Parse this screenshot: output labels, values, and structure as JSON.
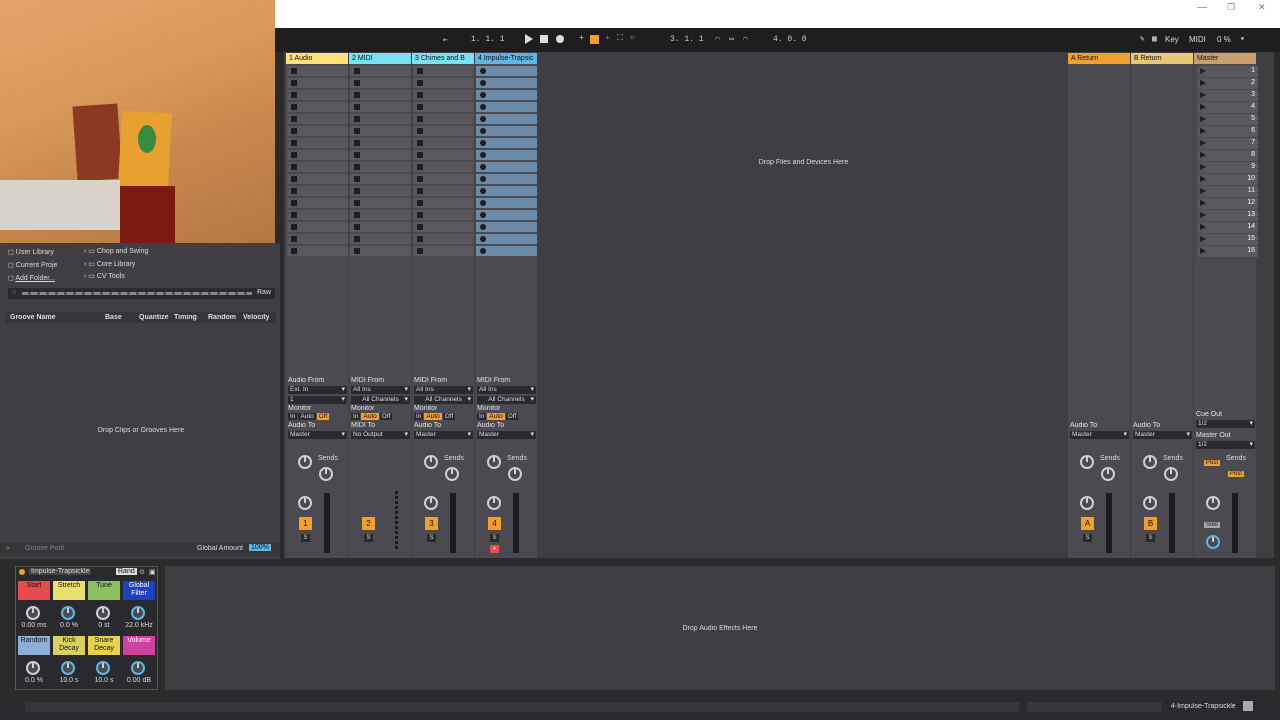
{
  "window": {
    "minimize": "—",
    "restore": "❐",
    "close": "✕"
  },
  "transport": {
    "arrangement_pos": "1.   1.   1",
    "loop_start": "3.   1.   1",
    "loop_length": "4.   0.   0",
    "key_label": "Key",
    "midi_label": "MIDI",
    "cpu": "0 %"
  },
  "browser": {
    "places": [
      "User Library",
      "Current Proje",
      "Add Folder..."
    ],
    "folders": [
      "Chop and Swing",
      "Core Library",
      "CV Tools"
    ],
    "raw_label": "Raw",
    "groove_columns": [
      "Groove Name",
      "Base",
      "Quantize",
      "Timing",
      "Random",
      "Velocity"
    ],
    "drop_grooves": "Drop Clips or Grooves Here",
    "groove_pool": "Groove Pool",
    "global_amount_label": "Global Amount",
    "global_amount_value": "100%"
  },
  "session": {
    "drop_files": "Drop Files and Devices Here",
    "tracks": [
      {
        "name": "1 Audio",
        "color": "#ffe07a",
        "number": "1",
        "from_label": "Audio From",
        "from_value": "Ext. In",
        "channel": "1",
        "to_label": "Audio To",
        "to_value": "Master"
      },
      {
        "name": "2 MIDI",
        "color": "#7be0f0",
        "number": "2",
        "from_label": "MIDI From",
        "from_value": "All Ins",
        "channel": "All Channels",
        "to_label": "MIDI To",
        "to_value": "No Output"
      },
      {
        "name": "3 Chimes and B",
        "color": "#7be0f0",
        "number": "3",
        "from_label": "MIDI From",
        "from_value": "All Ins",
        "channel": "All Channels",
        "to_label": "Audio To",
        "to_value": "Master"
      },
      {
        "name": "4 Impulse-Trapsic",
        "color": "#5fb6e0",
        "number": "4",
        "from_label": "MIDI From",
        "from_value": "All Ins",
        "channel": "All Channels",
        "to_label": "Audio To",
        "to_value": "Master"
      }
    ],
    "monitor_label": "Monitor",
    "monitor_options": [
      "In",
      "Auto",
      "Off"
    ],
    "sends_label": "Sends",
    "send_a": "A",
    "send_b": "B",
    "solo": "S",
    "returns": [
      {
        "name": "A Return",
        "color": "#f0a030",
        "letter": "A",
        "to_label": "Audio To",
        "to_value": "Master"
      },
      {
        "name": "B Return",
        "color": "#e8c878",
        "letter": "B",
        "to_label": "Audio To",
        "to_value": "Master"
      }
    ],
    "master": {
      "name": "Master",
      "color": "#c8a070",
      "cue_label": "Cue Out",
      "cue_value": "1/2",
      "out_label": "Master Out",
      "out_value": "1/2",
      "post": "Post",
      "solo": "Solo"
    },
    "scenes": [
      "1",
      "2",
      "3",
      "4",
      "5",
      "6",
      "7",
      "8",
      "9",
      "10",
      "11",
      "12",
      "13",
      "14",
      "15",
      "16"
    ]
  },
  "device": {
    "name": "Impulse-Trapsickle",
    "rand": "Rand",
    "pads_top": [
      {
        "label": "Start",
        "value": "0.00 ms",
        "color": "#e84a50"
      },
      {
        "label": "Stretch",
        "value": "0.0 %",
        "color": "#e8e070"
      },
      {
        "label": "Tune",
        "value": "0 st",
        "color": "#8cc060"
      },
      {
        "label": "Global\nFilter",
        "value": "22.0 kHz",
        "color": "#2040c0"
      }
    ],
    "pads_bottom": [
      {
        "label": "Random",
        "value": "0.0 %",
        "color": "#8ab0d8"
      },
      {
        "label": "Kick\nDecay",
        "value": "10.0 s",
        "color": "#d8d060"
      },
      {
        "label": "Snare\nDecay",
        "value": "10.0 s",
        "color": "#e8d050"
      },
      {
        "label": "Volume",
        "value": "0.00 dB",
        "color": "#d040a0"
      }
    ]
  },
  "fx": {
    "drop": "Drop Audio Effects Here"
  },
  "status": {
    "selected": "4-Impulse-Trapsickle"
  }
}
